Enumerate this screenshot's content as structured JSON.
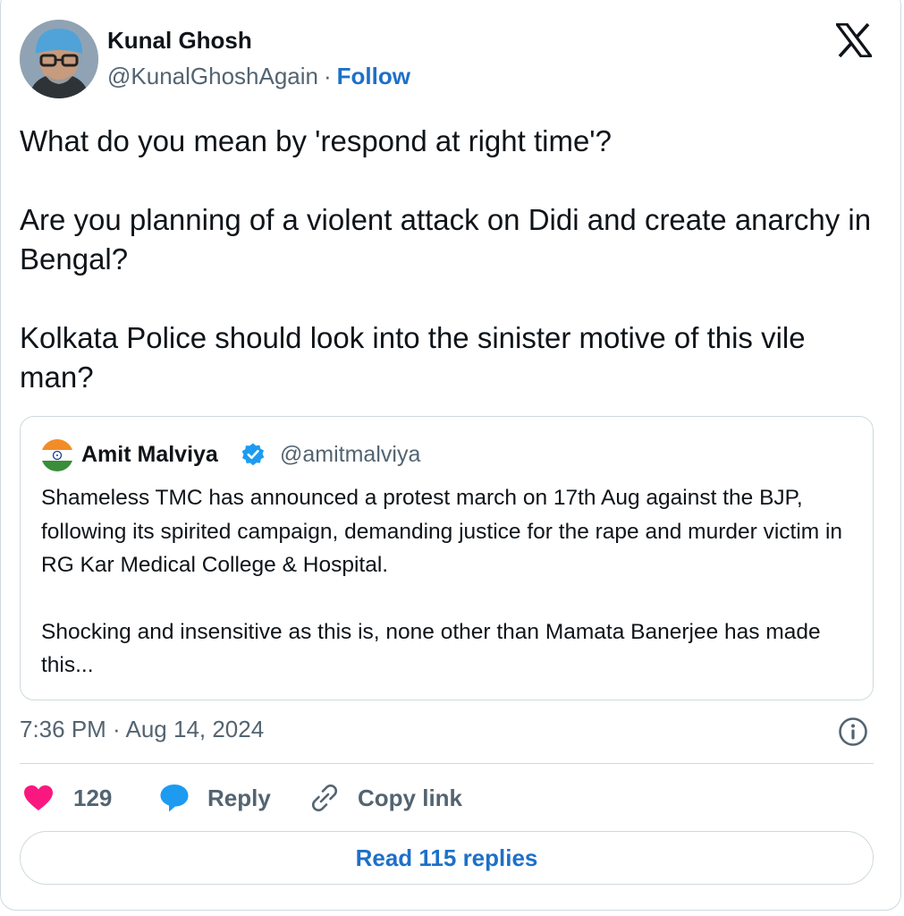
{
  "author": {
    "name": "Kunal Ghosh",
    "handle": "@KunalGhoshAgain",
    "separator": "·",
    "follow_label": "Follow"
  },
  "tweet": {
    "paragraphs": [
      "What do you mean by 'respond at right time'?",
      "Are you planning of a violent attack on Didi and create anarchy in Bengal?",
      "Kolkata Police should look into the sinister motive of this vile man?"
    ],
    "timestamp": "7:36 PM · Aug 14, 2024"
  },
  "quoted_tweet": {
    "name": "Amit Malviya",
    "handle": "@amitmalviya",
    "verified": true,
    "paragraphs": [
      "Shameless TMC has announced a protest march on 17th Aug against the BJP, following its spirited campaign, demanding justice for the rape and murder victim in RG Kar Medical College & Hospital.",
      "Shocking and insensitive as this is, none other than Mamata Banerjee has made this..."
    ]
  },
  "actions": {
    "like_count": "129",
    "reply_label": "Reply",
    "copy_link_label": "Copy link",
    "read_replies_label": "Read 115 replies"
  },
  "icons": {
    "brand": "x-logo-icon",
    "verified": "verified-badge-icon",
    "info": "info-icon",
    "like": "heart-icon",
    "reply": "speech-bubble-icon",
    "copy": "link-icon"
  },
  "colors": {
    "text": "#0f1419",
    "secondary": "#536471",
    "link": "#1d70c9",
    "like": "#f91880",
    "verified": "#1d9bf0",
    "border": "#cfd9de"
  }
}
